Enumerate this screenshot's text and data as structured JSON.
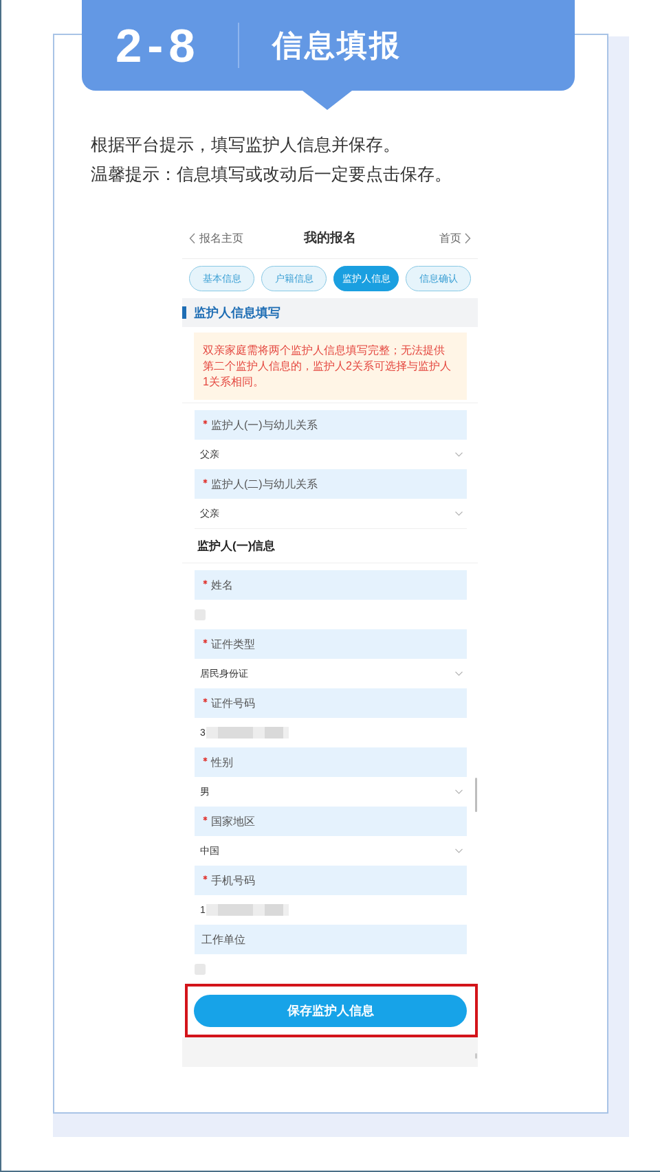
{
  "banner": {
    "number": "2-8",
    "title": "信息填报"
  },
  "instructions": [
    "根据平台提示，填写监护人信息并保存。",
    "温馨提示：信息填写或改动后一定要点击保存。"
  ],
  "app_screen": {
    "nav": {
      "back": "报名主页",
      "title": "我的报名",
      "forward": "首页"
    },
    "tabs": [
      {
        "label": "基本信息",
        "selected": false
      },
      {
        "label": "户籍信息",
        "selected": false
      },
      {
        "label": "监护人信息",
        "selected": true
      },
      {
        "label": "信息确认",
        "selected": false
      }
    ],
    "section_title": "监护人信息填写",
    "notice": "双亲家庭需将两个监护人信息填写完整；无法提供第二个监护人信息的，监护人2关系可选择与监护人1关系相同。",
    "relation_fields": [
      {
        "label": "监护人(一)与幼儿关系",
        "required": true,
        "kind": "select",
        "value": "父亲",
        "blurred": false
      },
      {
        "label": "监护人(二)与幼儿关系",
        "required": true,
        "kind": "select",
        "value": "父亲",
        "blurred": false
      }
    ],
    "guardian_heading": "监护人(一)信息",
    "guardian_fields": [
      {
        "label": "姓名",
        "required": true,
        "kind": "text",
        "blurred": true
      },
      {
        "label": "证件类型",
        "required": true,
        "kind": "select",
        "value": "居民身份证",
        "blurred": false
      },
      {
        "label": "证件号码",
        "required": true,
        "kind": "text",
        "value": "3",
        "blurred": true
      },
      {
        "label": "性别",
        "required": true,
        "kind": "select",
        "value": "男",
        "blurred": false
      },
      {
        "label": "国家地区",
        "required": true,
        "kind": "select",
        "value": "中国",
        "blurred": false
      },
      {
        "label": "手机号码",
        "required": true,
        "kind": "text",
        "value": "1",
        "blurred": true
      },
      {
        "label": "工作单位",
        "required": false,
        "kind": "text",
        "blurred": true
      }
    ],
    "save_button": {
      "label": "保存监护人信息",
      "highlighted": true
    }
  }
}
